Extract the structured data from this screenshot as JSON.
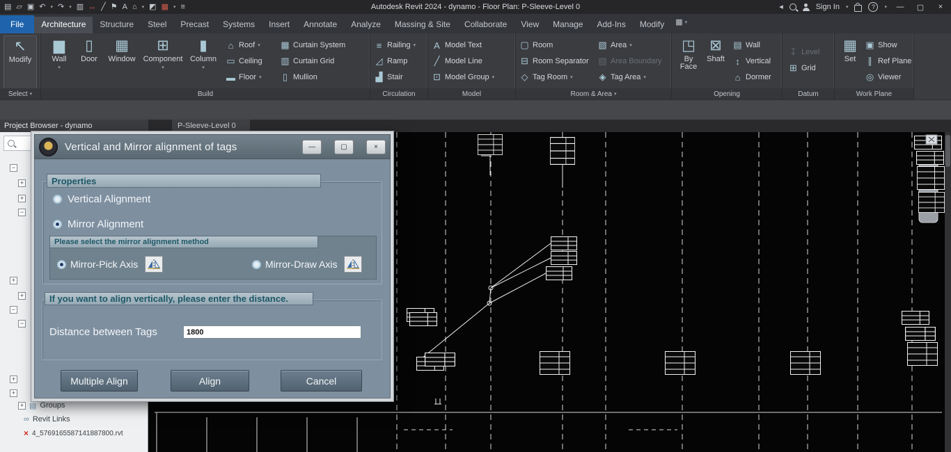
{
  "icons": {
    "caret": "▾",
    "expand": "+",
    "collapse": "−",
    "minimize": "—",
    "maximize": "▢",
    "close": "×",
    "back": "◂",
    "doc": "▤",
    "folder": "▱",
    "save": "▣",
    "undo": "↶",
    "redo": "↷",
    "print": "▥",
    "dim": "↔",
    "sline": "╱",
    "texta": "A",
    "home": "⌂",
    "section": "◩",
    "tiles": "▦",
    "thin": "≡",
    "flag": "⚑",
    "cursor": "↖",
    "wall": "▆",
    "door": "▯",
    "window": "▦",
    "component": "⊞",
    "column": "▮",
    "roof": "⌂",
    "ceiling": "▭",
    "floor": "▬",
    "csystem": "▦",
    "cgrid": "▥",
    "mullion": "▯",
    "railing": "≡",
    "ramp": "◿",
    "stair": "▟",
    "mtext": "A",
    "mline": "╱",
    "mgroup": "⊡",
    "room": "▢",
    "rsep": "⊟",
    "tagroom": "◇",
    "area": "▧",
    "aboundary": "▨",
    "tagarea": "◈",
    "byface": "◳",
    "shaft": "⊠",
    "owall": "▤",
    "overt": "↕",
    "dormer": "⌂",
    "level": "↧",
    "grid": "⊞",
    "set": "▦",
    "show": "▣",
    "refplane": "∥",
    "viewer": "◎",
    "link": "∞",
    "groupsic": "▤",
    "help": "?"
  },
  "titlebar": {
    "title": "Autodesk Revit 2024 - dynamo - Floor Plan: P-Sleeve-Level 0",
    "sign_in": "Sign In"
  },
  "tabs": [
    "File",
    "Architecture",
    "Structure",
    "Steel",
    "Precast",
    "Systems",
    "Insert",
    "Annotate",
    "Analyze",
    "Massing & Site",
    "Collaborate",
    "View",
    "Manage",
    "Add-Ins",
    "Modify"
  ],
  "ribbon": {
    "modify": "Modify",
    "labels": {
      "select": "Select",
      "build": "Build",
      "circulation": "Circulation",
      "model": "Model",
      "room_area": "Room & Area",
      "opening": "Opening",
      "datum": "Datum",
      "work_plane": "Work Plane"
    },
    "build": {
      "bigs": [
        "Wall",
        "Door",
        "Window",
        "Component",
        "Column"
      ],
      "col1": [
        "Roof",
        "Ceiling",
        "Floor"
      ],
      "col2": [
        "Curtain System",
        "Curtain Grid",
        "Mullion"
      ]
    },
    "circulation": [
      "Railing",
      "Ramp",
      "Stair"
    ],
    "model": [
      "Model Text",
      "Model Line",
      "Model Group"
    ],
    "room": [
      "Room",
      "Room Separator",
      "Tag Room"
    ],
    "area": [
      "Area",
      "Area Boundary",
      "Tag Area"
    ],
    "opening": {
      "bigs": [
        "By Face",
        "Shaft"
      ],
      "smalls": [
        "Wall",
        "Vertical",
        "Dormer"
      ]
    },
    "datum": [
      "Level",
      "Grid"
    ],
    "work_plane": {
      "big": "Set",
      "smalls": [
        "Show",
        "Ref Plane",
        "Viewer"
      ]
    }
  },
  "browser": {
    "title": "Project Browser - dynamo",
    "groups": "Groups",
    "revit_links": "Revit Links",
    "link_file": "4_5769165587141887800.rvt"
  },
  "view_tab": "P-Sleeve-Level 0",
  "dialog": {
    "title": "Vertical and Mirror alignment of tags",
    "properties": "Properties",
    "vertical": "Vertical Alignment",
    "mirror": "Mirror Alignment",
    "method_header": "Please select the mirror alignment method",
    "pick": "Mirror-Pick Axis",
    "draw": "Mirror-Draw Axis",
    "distance_header": "If you want to align vertically, please enter the distance.",
    "distance_label": "Distance between Tags",
    "distance_value": "1800",
    "multiple_align": "Multiple Align",
    "align": "Align",
    "cancel": "Cancel"
  }
}
